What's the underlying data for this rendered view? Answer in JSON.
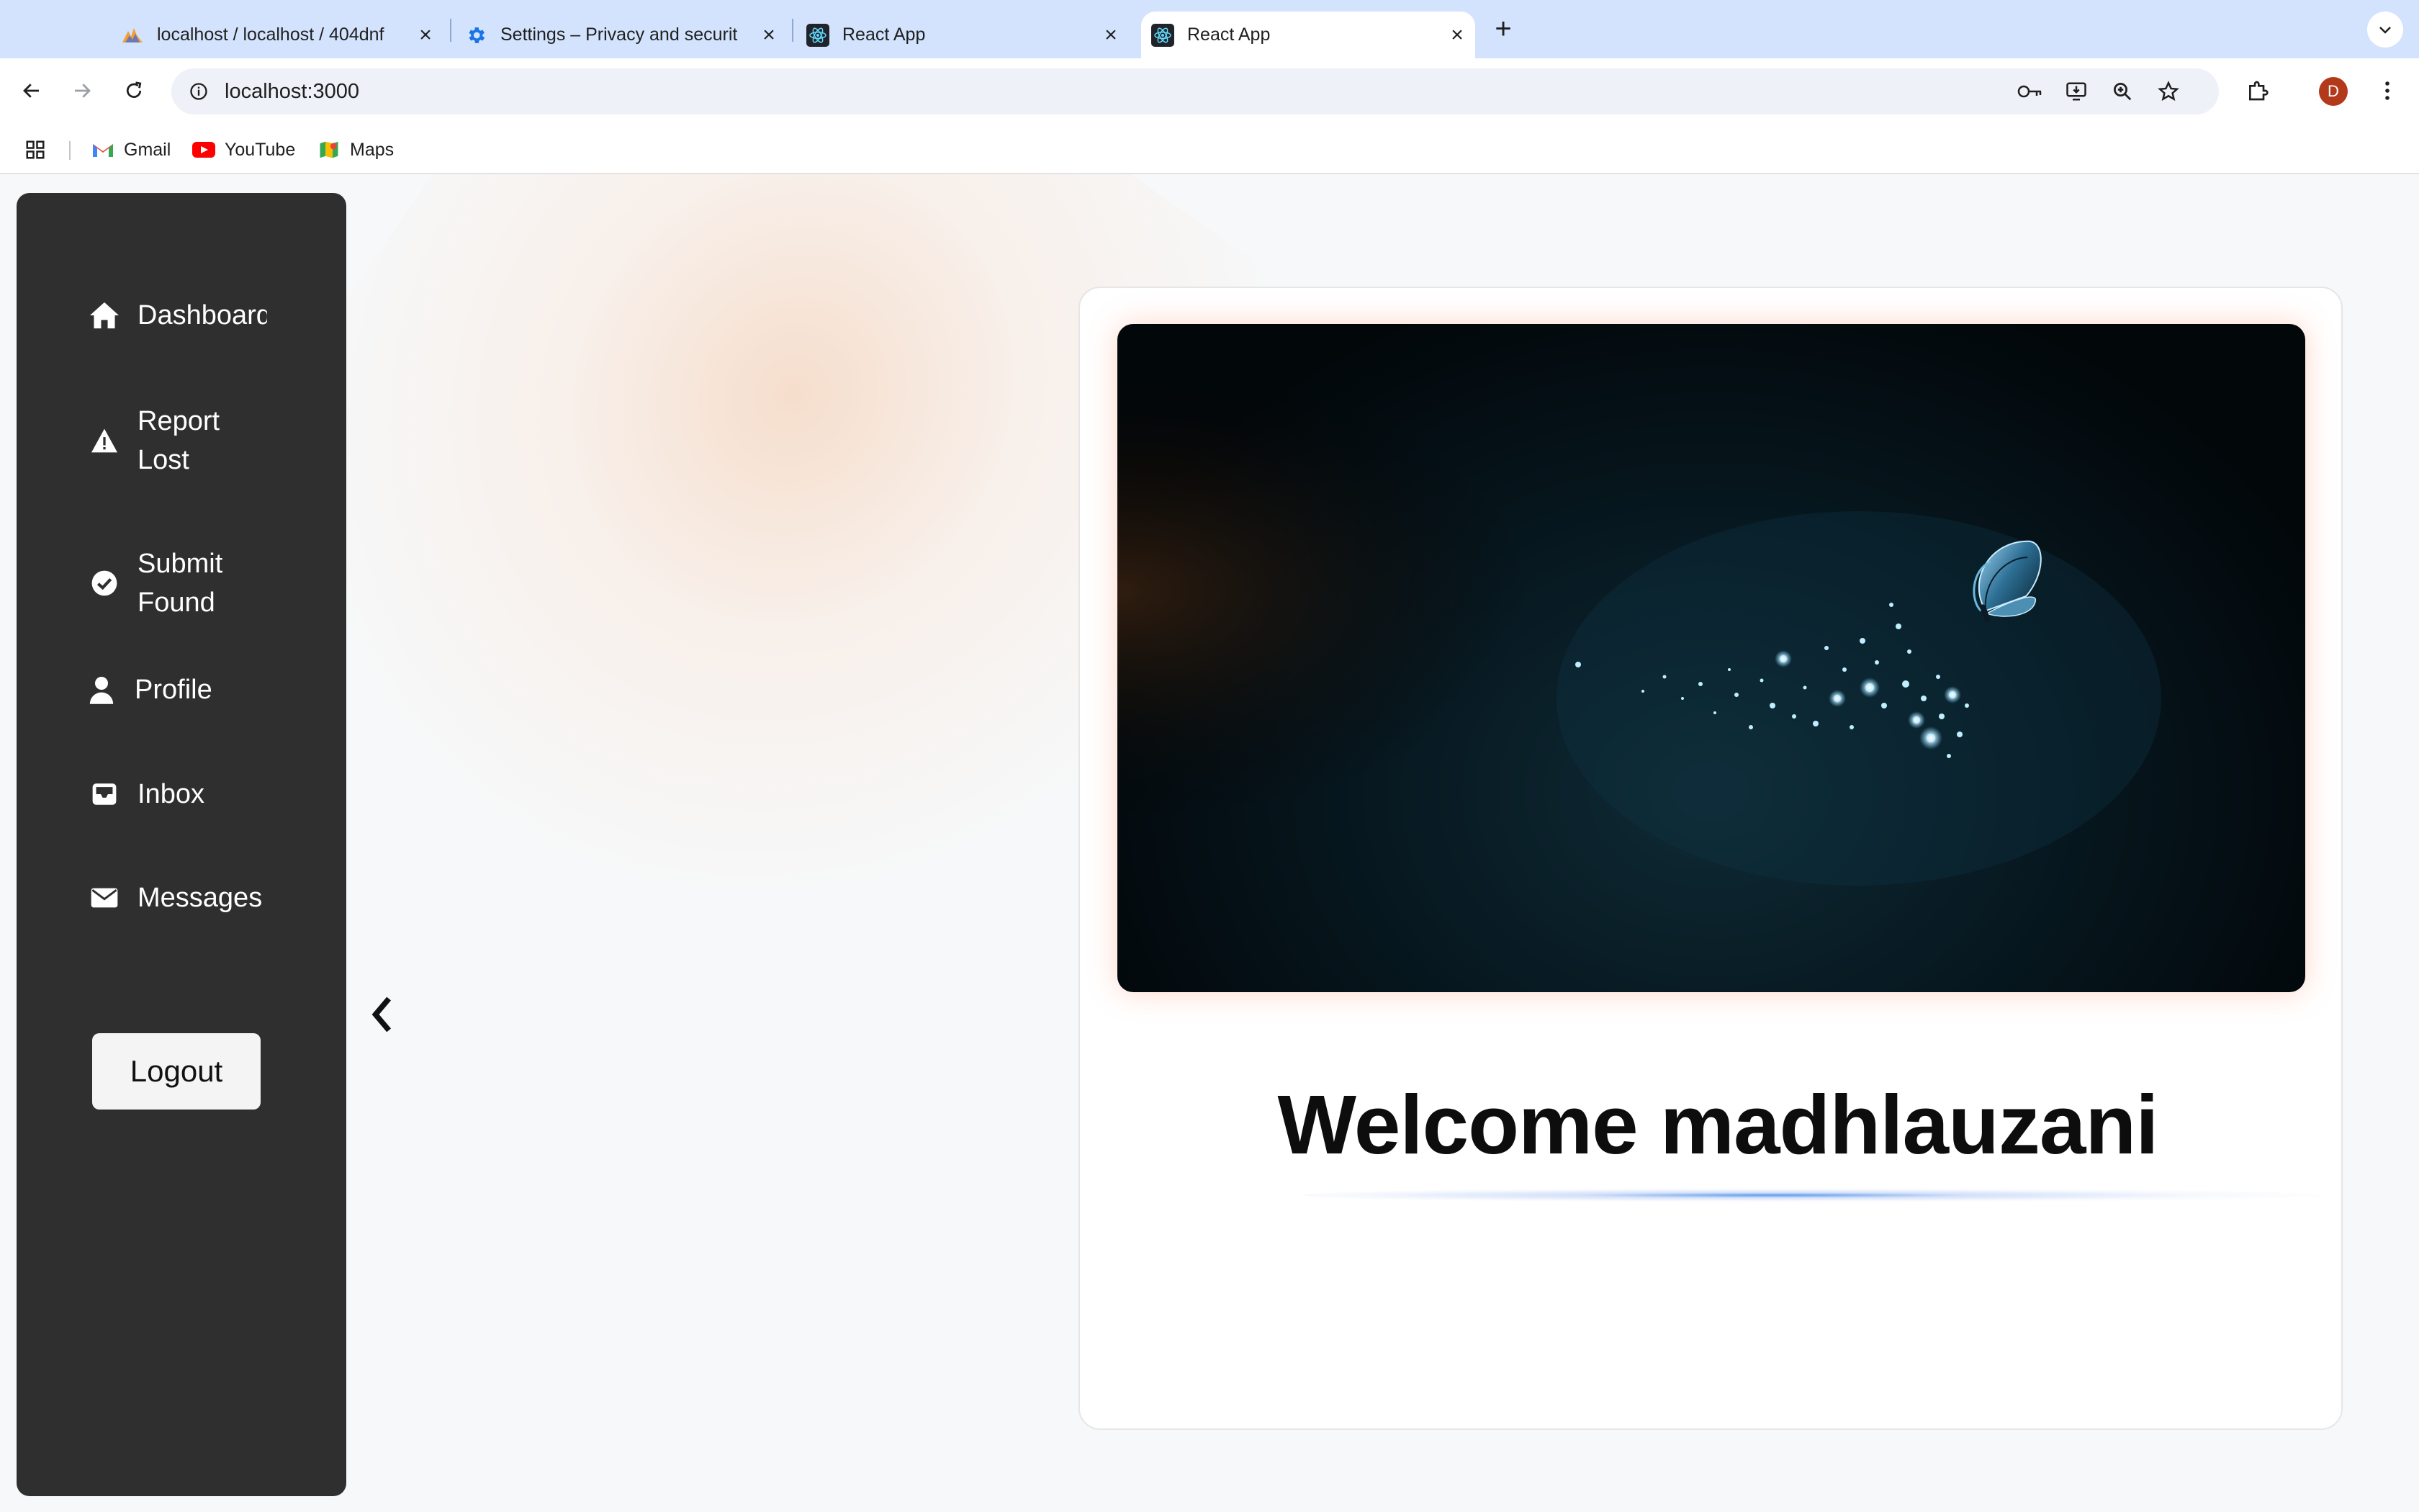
{
  "browser": {
    "tabs": [
      {
        "title": "localhost / localhost / 404dnf",
        "icon": "phpmyadmin-icon",
        "active": false
      },
      {
        "title": "Settings – Privacy and securit",
        "icon": "settings-gear-icon",
        "active": false
      },
      {
        "title": "React App",
        "icon": "react-icon",
        "active": false
      },
      {
        "title": "React App",
        "icon": "react-icon",
        "active": true
      }
    ],
    "url": "localhost:3000",
    "profile_initial": "D",
    "bookmarks": [
      {
        "label": "Gmail",
        "icon": "gmail-icon"
      },
      {
        "label": "YouTube",
        "icon": "youtube-icon"
      },
      {
        "label": "Maps",
        "icon": "maps-icon"
      }
    ]
  },
  "sidebar": {
    "items": [
      {
        "label": "Dashboard",
        "icon": "home-icon"
      },
      {
        "label": "Report Lost",
        "icon": "warning-icon"
      },
      {
        "label": "Submit Found",
        "icon": "check-circle-icon"
      },
      {
        "label": "Profile",
        "icon": "user-icon"
      },
      {
        "label": "Inbox",
        "icon": "inbox-icon"
      },
      {
        "label": "Messages",
        "icon": "envelope-icon"
      }
    ],
    "logout_label": "Logout"
  },
  "main": {
    "welcome_text": "Welcome madhlauzani"
  },
  "colors": {
    "sidebar_bg": "#2f2f2f",
    "tabbar_bg": "#d3e3fd",
    "accent_blue": "#468ce6",
    "avatar_bg": "#b3391b"
  }
}
